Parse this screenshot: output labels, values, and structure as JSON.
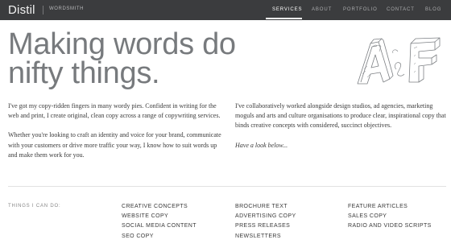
{
  "brand": {
    "logo": "Distil",
    "tagline": "WORDSMITH"
  },
  "nav": {
    "items": [
      {
        "label": "SERVICES",
        "active": true
      },
      {
        "label": "ABOUT",
        "active": false
      },
      {
        "label": "PORTFOLIO",
        "active": false
      },
      {
        "label": "CONTACT",
        "active": false
      },
      {
        "label": "BLOG",
        "active": false
      }
    ]
  },
  "hero": {
    "headline": "Making words do nifty things.",
    "illustration": "sketched-letters-a-and-f"
  },
  "intro": {
    "left": [
      "I've got my copy-ridden fingers in many wordy pies. Confident in writing for the web and print, I create original, clean copy across a range of copywriting services.",
      "Whether you're looking to craft an identity and voice for your brand, communicate with your customers or drive more traffic your way, I know how to suit words up and make them work for you."
    ],
    "right": [
      "I've collaboratively worked alongside design studios, ad agencies, marketing moguls and arts and culture organisations to produce clear, inspirational copy that binds creative concepts with considered, succinct objectives."
    ],
    "cta": "Have a look below..."
  },
  "services": {
    "label": "THINGS I CAN DO:",
    "columns": [
      [
        "CREATIVE CONCEPTS",
        "WEBSITE COPY",
        "SOCIAL MEDIA CONTENT",
        "SEO COPY"
      ],
      [
        "BROCHURE TEXT",
        "ADVERTISING COPY",
        "PRESS RELEASES",
        "NEWSLETTERS"
      ],
      [
        "FEATURE ARTICLES",
        "SALES COPY",
        "RADIO AND VIDEO SCRIPTS"
      ]
    ]
  },
  "colors": {
    "topbar": "#3b3c3e",
    "headline": "#777a7d",
    "body_text": "#3a3a3a"
  }
}
